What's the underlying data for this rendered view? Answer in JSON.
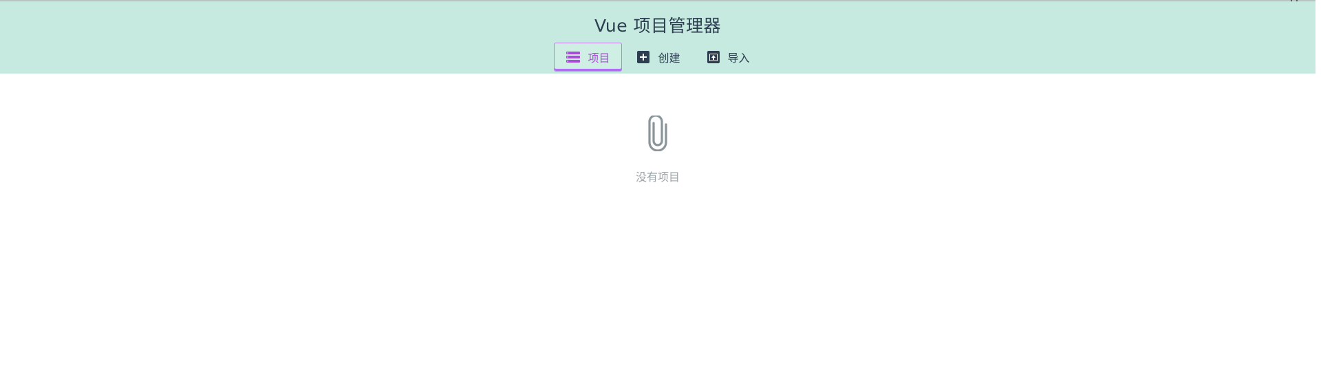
{
  "app": {
    "title": "Vue 项目管理器"
  },
  "tabs": [
    {
      "label": "项目",
      "icon": "list-icon",
      "active": true
    },
    {
      "label": "创建",
      "icon": "plus-square-icon",
      "active": false
    },
    {
      "label": "导入",
      "icon": "import-box-icon",
      "active": false
    }
  ],
  "empty_state": {
    "icon": "paperclip-icon",
    "text": "没有项目"
  },
  "colors": {
    "header_bg": "#c6eadf",
    "active_accent": "#a64cd8",
    "text_dark": "#2c3e50",
    "muted": "#9aa3a7"
  }
}
